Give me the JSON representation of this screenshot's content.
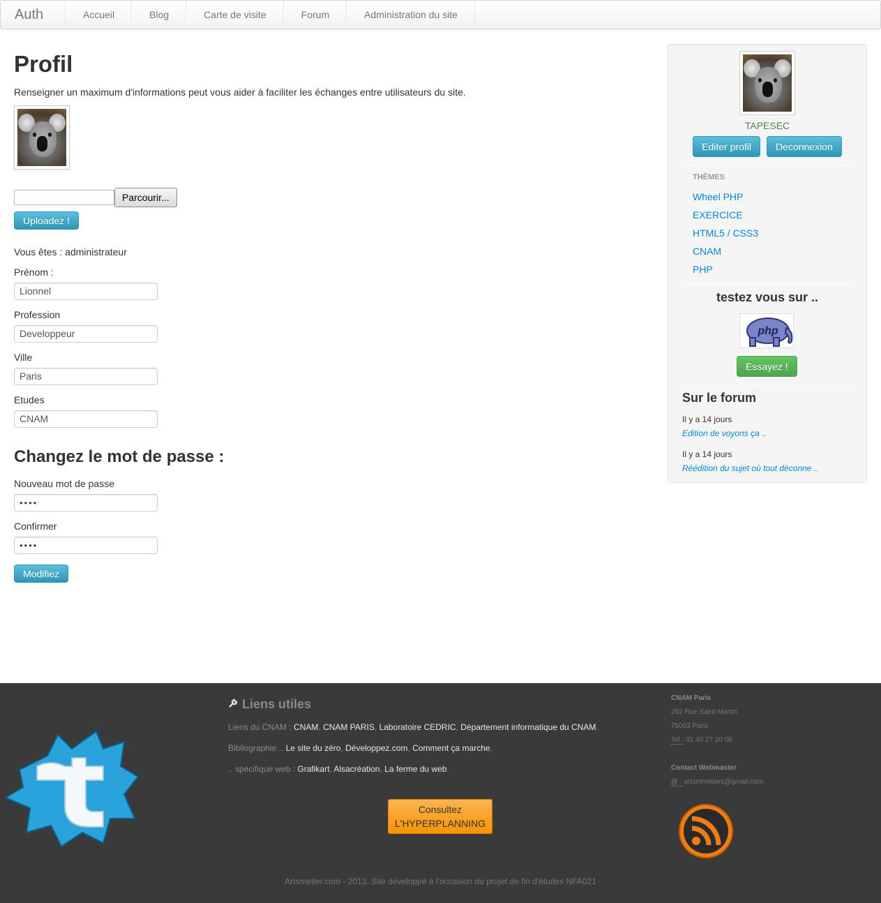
{
  "navbar": {
    "brand": "Auth",
    "items": [
      {
        "label": "Accueil"
      },
      {
        "label": "Blog"
      },
      {
        "label": "Carte de visite"
      },
      {
        "label": "Forum"
      },
      {
        "label": "Administration du site"
      }
    ]
  },
  "profile": {
    "title": "Profil",
    "intro": "Renseigner un maximum d'informations peut vous aider à faciliter les échanges entre utilisateurs du site.",
    "browse_label": "Parcourir...",
    "upload_label": "Uploadez !",
    "role_text": "Vous êtes : administrateur",
    "fields": [
      {
        "label": "Prénom :",
        "value": "Lionnel"
      },
      {
        "label": "Profession",
        "value": "Developpeur"
      },
      {
        "label": "Ville",
        "value": "Paris"
      },
      {
        "label": "Etudes",
        "value": "CNAM"
      }
    ],
    "password_section": {
      "title": "Changez le mot de passe :",
      "new_label": "Nouveau mot de passe",
      "new_value": "••••",
      "confirm_label": "Confirmer",
      "confirm_value": "••••",
      "submit_label": "Modifiez"
    }
  },
  "sidebar": {
    "username": "TAPESEC",
    "edit_label": "Editer profil",
    "logout_label": "Deconnexion",
    "themes_header": "THÈMES",
    "themes": [
      "Wheel PHP",
      "EXERCICE",
      "HTML5 / CSS3",
      "CNAM",
      "PHP"
    ],
    "test_title": "testez vous sur ..",
    "php_logo_text": "php",
    "try_label": "Essayez !",
    "forum_title": "Sur le forum",
    "forum_items": [
      {
        "when": "Il y a 14 jours",
        "link": "Edition de voyons ça .."
      },
      {
        "when": "Il y a 14 jours",
        "link": "Réédition du sujet où tout déconne .."
      }
    ]
  },
  "footer": {
    "liens_title": "Liens utiles",
    "liens_cnam_prefix": "Liens du CNAM :",
    "liens_cnam": [
      "CNAM",
      "CNAM PARIS",
      "Laboratoire CEDRIC",
      "Département informatique du CNAM"
    ],
    "biblio_prefix": "Bibliographie ..",
    "biblio": [
      "Le site du zéro",
      "Développez.com",
      "Comment ça marche"
    ],
    "web_prefix": ".. spécifique web :",
    "web": [
      "Grafikart",
      "Alsacréation",
      "La ferme du web"
    ],
    "hyper_line1": "Consultez",
    "hyper_line2": "L'HYPERPLANNING",
    "contact": {
      "name": "CNAM Paris",
      "street": "292 Rue Saint-Martin",
      "city": "75003 Paris",
      "tel_label": "Tel :",
      "tel": "01 40 27 20 00",
      "webmaster_header": "Contact Webmaster",
      "email_label": "@ :",
      "email": "artsetmetiers@gmail.com"
    },
    "copyright": "Artsmetier.com - 2013. Site développé à l'occasion du projet de fin d'études NFA021"
  },
  "colors": {
    "info": "#2f96b4",
    "success": "#51a351",
    "link": "#0088cc",
    "footer_bg": "#3a3a3a",
    "warning": "#f89406",
    "username": "#468847"
  }
}
